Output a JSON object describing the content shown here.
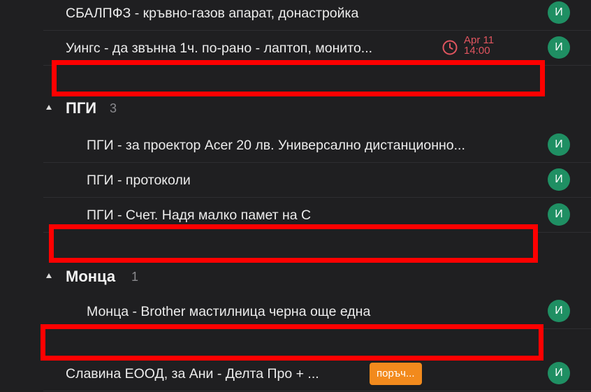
{
  "rows_top": [
    {
      "title": "СБАЛПФЗ - кръвно-газов апарат, донастройка",
      "avatar": "И"
    },
    {
      "title": "Уингс - да звънна 1ч. по-рано - лаптоп, монито...",
      "avatar": "И",
      "due": {
        "date": "Apr 11",
        "time": "14:00"
      }
    }
  ],
  "groups": [
    {
      "name": "ПГИ",
      "count": "3",
      "rows": [
        {
          "title": "ПГИ - за проектор Acer 20 лв. Универсално дистанционно...",
          "avatar": "И"
        },
        {
          "title": "ПГИ - протоколи",
          "avatar": "И"
        },
        {
          "title": "ПГИ - Счет. Надя малко памет на С",
          "avatar": "И"
        }
      ]
    },
    {
      "name": "Монца",
      "count": "1",
      "rows": [
        {
          "title": "Монца - Brother мастилница черна още една",
          "avatar": "И"
        }
      ]
    }
  ],
  "rows_bottom": [
    {
      "title": "Славина ЕООД, за Ани - Делта Про + ...",
      "avatar": "И",
      "tag": "поръч..."
    }
  ],
  "colors": {
    "background": "#1f1f21",
    "avatar": "#1f8f63",
    "due": "#e0555f",
    "tag": "#f28a1d",
    "highlight_box": "#ff0000"
  }
}
